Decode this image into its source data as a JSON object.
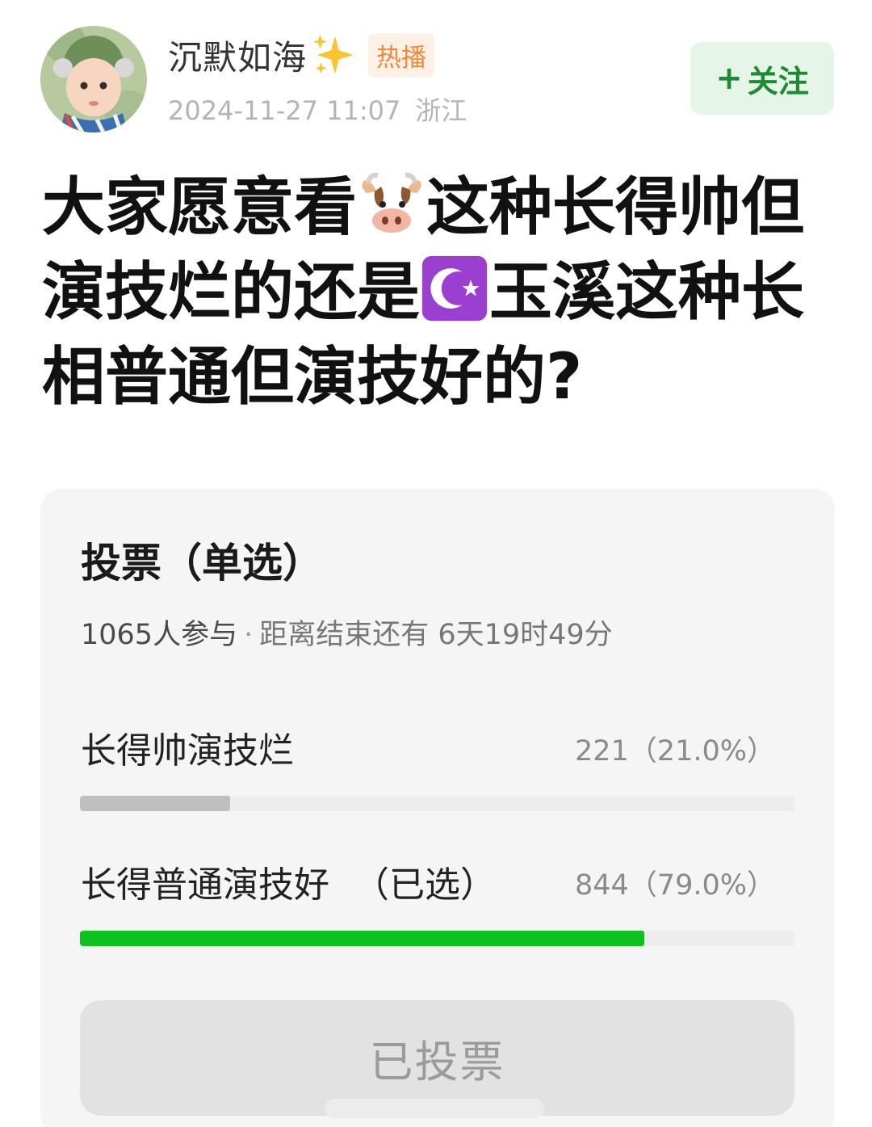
{
  "post": {
    "username": "沉默如海",
    "badge": "热播",
    "timestamp": "2024-11-27 11:07",
    "location": "浙江",
    "follow_label": "关注",
    "follow_plus": "+",
    "title_part1": "大家愿意看",
    "title_part2": "这种长得帅但演技烂的还是",
    "title_part3": "玉溪这种长相普通但演技好的?",
    "icons": [
      "sparkles-emoji",
      "cow-face-emoji",
      "star-and-crescent-emoji"
    ]
  },
  "poll": {
    "title": "投票（单选）",
    "participants": "1065人参与",
    "separator": "·",
    "remaining": "距离结束还有 6天19时49分",
    "options": [
      {
        "label": "长得帅演技烂",
        "selected_tag": "",
        "count_text": "221（21.0%）",
        "share": 0.21,
        "color": "#bfbfbf"
      },
      {
        "label": "长得普通演技好",
        "selected_tag": "（已选）",
        "count_text": "844（79.0%）",
        "share": 0.79,
        "color": "#0fc11f"
      }
    ],
    "button_label": "已投票"
  }
}
